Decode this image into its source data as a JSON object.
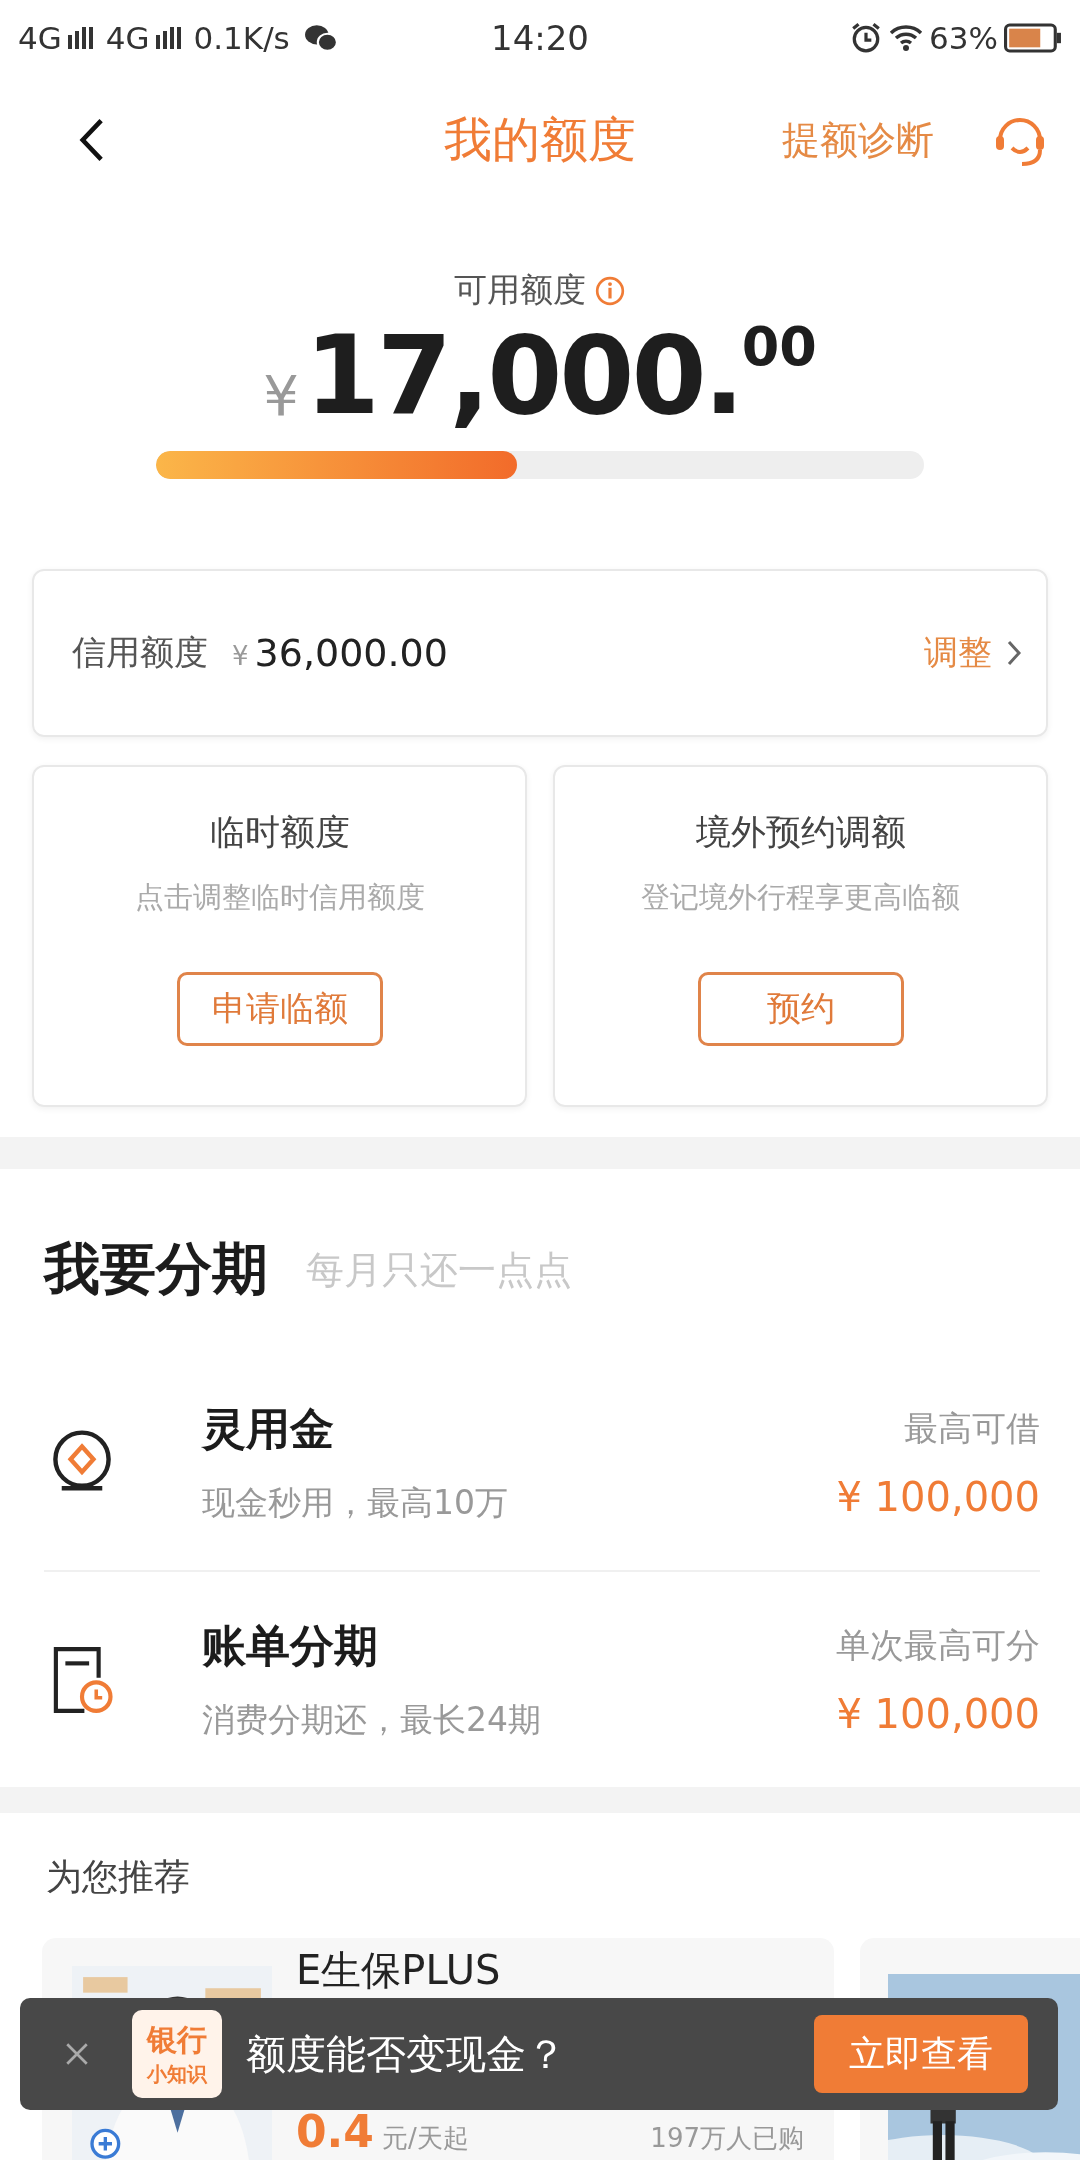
{
  "status_bar": {
    "network_1": "4G",
    "network_2": "4G",
    "speed": "0.1K/s",
    "time": "14:20",
    "battery": "63%"
  },
  "header": {
    "title": "我的额度",
    "action": "提额诊断"
  },
  "available": {
    "label": "可用额度",
    "currency": "¥",
    "amount": "17,000.",
    "decimals": "00",
    "level": 0.47
  },
  "credit_limit": {
    "label": "信用额度",
    "currency": "¥",
    "amount": "36,000.00",
    "action": "调整"
  },
  "cards": [
    {
      "title": "临时额度",
      "subtitle": "点击调整临时信用额度",
      "button": "申请临额"
    },
    {
      "title": "境外预约调额",
      "subtitle": "登记境外行程享更高临额",
      "button": "预约"
    }
  ],
  "installments": {
    "title": "我要分期",
    "subtitle": "每月只还一点点",
    "items": [
      {
        "kind": "loan",
        "title": "灵用金",
        "subtitle": "现金秒用，最高10万",
        "label": "最高可借",
        "amount": "¥ 100,000"
      },
      {
        "kind": "bill",
        "title": "账单分期",
        "subtitle": "消费分期还，最长24期",
        "label": "单次最高可分",
        "amount": "¥ 100,000"
      }
    ]
  },
  "recommend": {
    "title": "为您推荐",
    "products": [
      {
        "name": "E生保PLUS",
        "price": "0.4",
        "unit": "元/天起",
        "buyers": "197万人已购"
      }
    ]
  },
  "toast": {
    "logo_line_1": "银行",
    "logo_line_2": "小知识",
    "text": "额度能否变现金？",
    "button": "立即查看"
  }
}
